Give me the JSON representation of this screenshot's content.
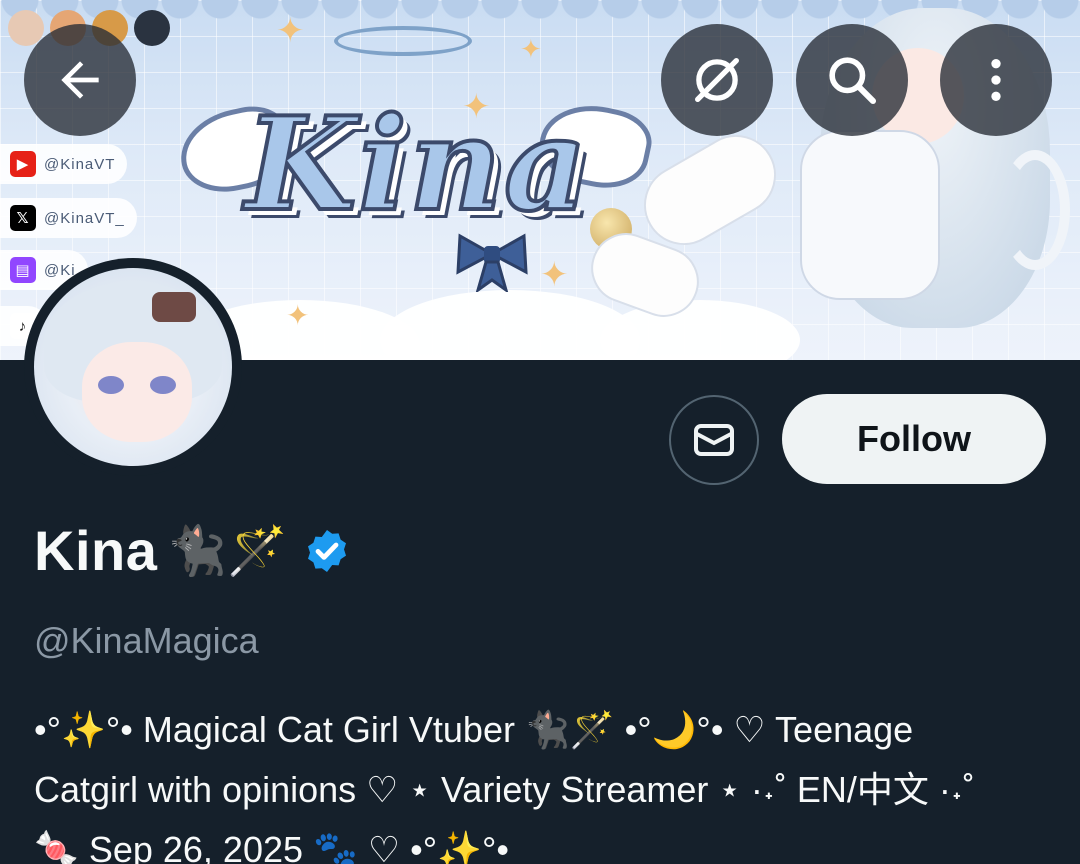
{
  "header": {
    "back_icon": "arrow-left-icon",
    "actions": [
      "crossed-circle-icon",
      "search-icon",
      "more-vertical-icon"
    ]
  },
  "banner": {
    "logo_text": "Kina",
    "socials": [
      {
        "platform": "youtube",
        "handle": "@KinaVT"
      },
      {
        "platform": "x",
        "handle": "@KinaVT_"
      },
      {
        "platform": "twitch",
        "handle": "@Ki"
      },
      {
        "platform": "tiktok",
        "handle": ""
      }
    ]
  },
  "profile": {
    "display_name": "Kina",
    "name_emoji": "🐈‍⬛🪄",
    "verified": true,
    "handle": "@KinaMagica",
    "bio_lines": [
      "•°✨°• Magical Cat Girl Vtuber 🐈‍⬛🪄 •°🌙°• ♡ Teenage",
      "Catgirl with opinions ♡ ⋆ Variety Streamer ⋆ ·˖˚ EN/中文 ·˖˚",
      "🍬 Sep 26, 2025 🐾 ♡ •°✨°•"
    ]
  },
  "actions": {
    "message_icon": "envelope-icon",
    "follow_label": "Follow"
  },
  "colors": {
    "background": "#15202b",
    "verified_blue": "#1d9bf0",
    "follow_bg": "#eff3f4",
    "handle_gray": "#8b98a5"
  }
}
